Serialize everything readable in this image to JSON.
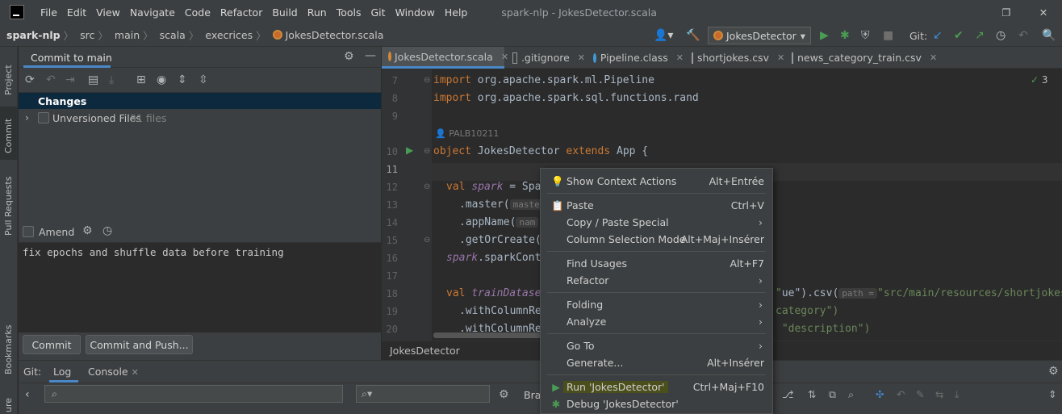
{
  "menubar": {
    "items": [
      "File",
      "Edit",
      "View",
      "Navigate",
      "Code",
      "Refactor",
      "Build",
      "Run",
      "Tools",
      "Git",
      "Window",
      "Help"
    ],
    "window_title": "spark-nlp - JokesDetector.scala"
  },
  "breadcrumb": [
    "spark-nlp",
    "src",
    "main",
    "scala",
    "execrices",
    "JokesDetector.scala"
  ],
  "toolbar": {
    "run_config": "JokesDetector",
    "git_label": "Git:"
  },
  "left_stripe": {
    "project": "Project",
    "commit": "Commit",
    "pull_requests": "Pull Requests",
    "bookmarks": "Bookmarks",
    "structure": "ure"
  },
  "commit_panel": {
    "title": "Commit to main",
    "changes_label": "Changes",
    "unversioned_label": "Unversioned Files",
    "unversioned_count": "31 files",
    "amend_label": "Amend",
    "message": "fix epochs and shuffle data before training",
    "commit_button": "Commit",
    "commit_push_button": "Commit and Push..."
  },
  "editor_tabs": [
    {
      "label": "JokesDetector.scala",
      "active": true
    },
    {
      "label": ".gitignore",
      "active": false
    },
    {
      "label": "Pipeline.class",
      "active": false
    },
    {
      "label": "shortjokes.csv",
      "active": false
    },
    {
      "label": "news_category_train.csv",
      "active": false
    }
  ],
  "editor": {
    "inspection_count": "3",
    "author": "PALB10211",
    "line_numbers": [
      "7",
      "8",
      "9",
      "10",
      "11",
      "12",
      "13",
      "14",
      "15",
      "16",
      "17",
      "18",
      "19",
      "20"
    ],
    "lines": {
      "l7_kw": "import",
      "l7_rest": " org.apache.spark.ml.Pipeline",
      "l8_kw": "import",
      "l8_rest": " org.apache.spark.sql.functions.rand",
      "l10_kw1": "object",
      "l10_name": " JokesDetector ",
      "l10_kw2": "extends",
      "l10_rest": " App {",
      "l12_kw": "val",
      "l12_var": "spark",
      "l12_rest": " = Spa",
      "l13": ".master(",
      "l13_hint": "master",
      "l14": ".appName(",
      "l14_hint": "nam",
      "l15": ".getOrCreate(",
      "l16_var": "spark",
      "l16_rest": ".sparkCont",
      "l18_kw": "val",
      "l18_var": "trainDatase",
      "l18_tail": "ue\").csv(",
      "l18_hint": "path =",
      "l18_str": "\"src/main/resources/shortjokes",
      "l19": ".withColumnRe",
      "l19_tail": "category\")",
      "l20": ".withColumnRe",
      "l20_tail": " \"description\")"
    },
    "status_file": "JokesDetector"
  },
  "git_panel": {
    "git_label": "Git:",
    "log_tab": "Log",
    "console_tab": "Console",
    "branch_label": "Bran"
  },
  "context_menu": {
    "items": [
      {
        "label": "Show Context Actions",
        "shortcut": "Alt+Entrée"
      },
      {
        "label": "Paste",
        "shortcut": "Ctrl+V"
      },
      {
        "label": "Copy / Paste Special",
        "shortcut": ""
      },
      {
        "label": "Column Selection Mode",
        "shortcut": "Alt+Maj+Insérer"
      },
      {
        "label": "Find Usages",
        "shortcut": "Alt+F7"
      },
      {
        "label": "Refactor",
        "shortcut": ""
      },
      {
        "label": "Folding",
        "shortcut": ""
      },
      {
        "label": "Analyze",
        "shortcut": ""
      },
      {
        "label": "Go To",
        "shortcut": ""
      },
      {
        "label": "Generate...",
        "shortcut": "Alt+Insérer"
      },
      {
        "label": "Run 'JokesDetector'",
        "shortcut": "Ctrl+Maj+F10"
      },
      {
        "label": "Debug 'JokesDetector'",
        "shortcut": ""
      }
    ]
  },
  "colors": {
    "accent": "#4a88c7",
    "run_green": "#499c54",
    "highlight": "#4b4f1b"
  }
}
